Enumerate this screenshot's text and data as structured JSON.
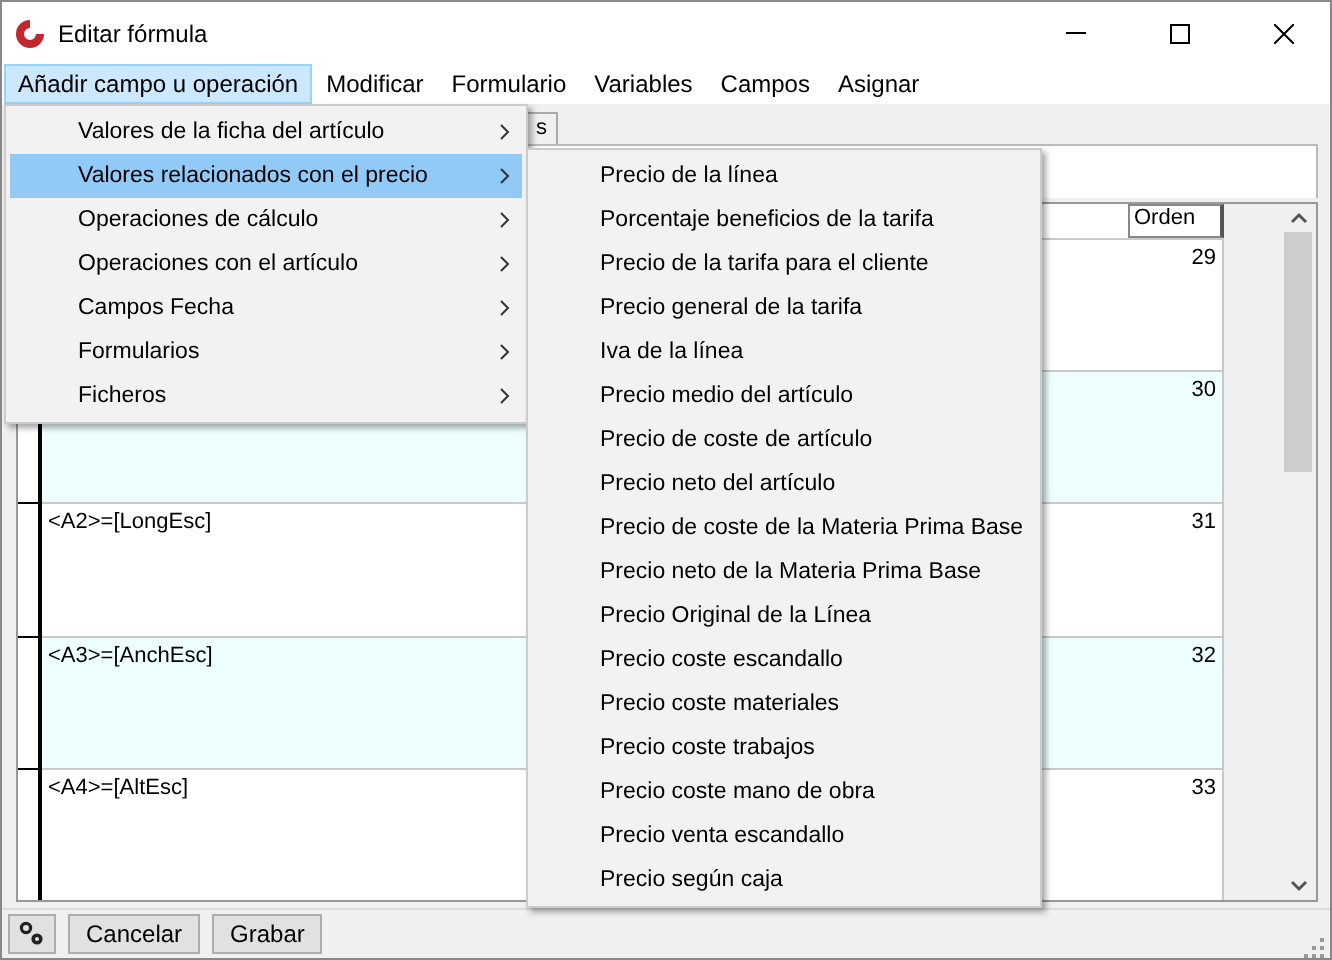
{
  "window": {
    "title": "Editar fórmula"
  },
  "menu_bar": [
    {
      "label": "Añadir campo u operación",
      "selected": true
    },
    {
      "label": "Modificar",
      "selected": false
    },
    {
      "label": "Formulario",
      "selected": false
    },
    {
      "label": "Variables",
      "selected": false
    },
    {
      "label": "Campos",
      "selected": false
    },
    {
      "label": "Asignar",
      "selected": false
    }
  ],
  "tabs": [
    {
      "label": "s",
      "selected": false
    }
  ],
  "table": {
    "columns": [
      "Orden"
    ],
    "rows": [
      {
        "formula": "",
        "orden": "29"
      },
      {
        "formula": "",
        "orden": "30"
      },
      {
        "formula": "<A2>=[LongEsc]",
        "orden": "31"
      },
      {
        "formula": "<A3>=[AnchEsc]",
        "orden": "32"
      },
      {
        "formula": "<A4>=[AltEsc]",
        "orden": "33"
      }
    ]
  },
  "dropdown": {
    "items": [
      {
        "label": "Valores de la ficha del artículo",
        "selected": false,
        "submenu": true
      },
      {
        "label": "Valores relacionados con el precio",
        "selected": true,
        "submenu": true
      },
      {
        "label": "Operaciones de cálculo",
        "selected": false,
        "submenu": true
      },
      {
        "label": "Operaciones con el artículo",
        "selected": false,
        "submenu": true
      },
      {
        "label": "Campos Fecha",
        "selected": false,
        "submenu": true
      },
      {
        "label": "Formularios",
        "selected": false,
        "submenu": true
      },
      {
        "label": "Ficheros",
        "selected": false,
        "submenu": true
      }
    ]
  },
  "submenu": {
    "items": [
      "Precio de la línea",
      "Porcentaje beneficios de la tarifa",
      "Precio de la tarifa para el cliente",
      "Precio general de la tarifa",
      "Iva de la línea",
      "Precio medio del artículo",
      "Precio de coste de artículo",
      "Precio neto del artículo",
      "Precio de coste de la Materia Prima Base",
      "Precio neto de la Materia Prima Base",
      "Precio Original de la Línea",
      "Precio coste escandallo",
      "Precio coste materiales",
      "Precio coste trabajos",
      "Precio coste mano de obra",
      "Precio venta escandallo",
      "Precio según caja"
    ]
  },
  "buttons": [
    {
      "kind": "icon"
    },
    {
      "kind": "text",
      "label": "Cancelar"
    },
    {
      "kind": "text",
      "label": "Grabar"
    }
  ]
}
